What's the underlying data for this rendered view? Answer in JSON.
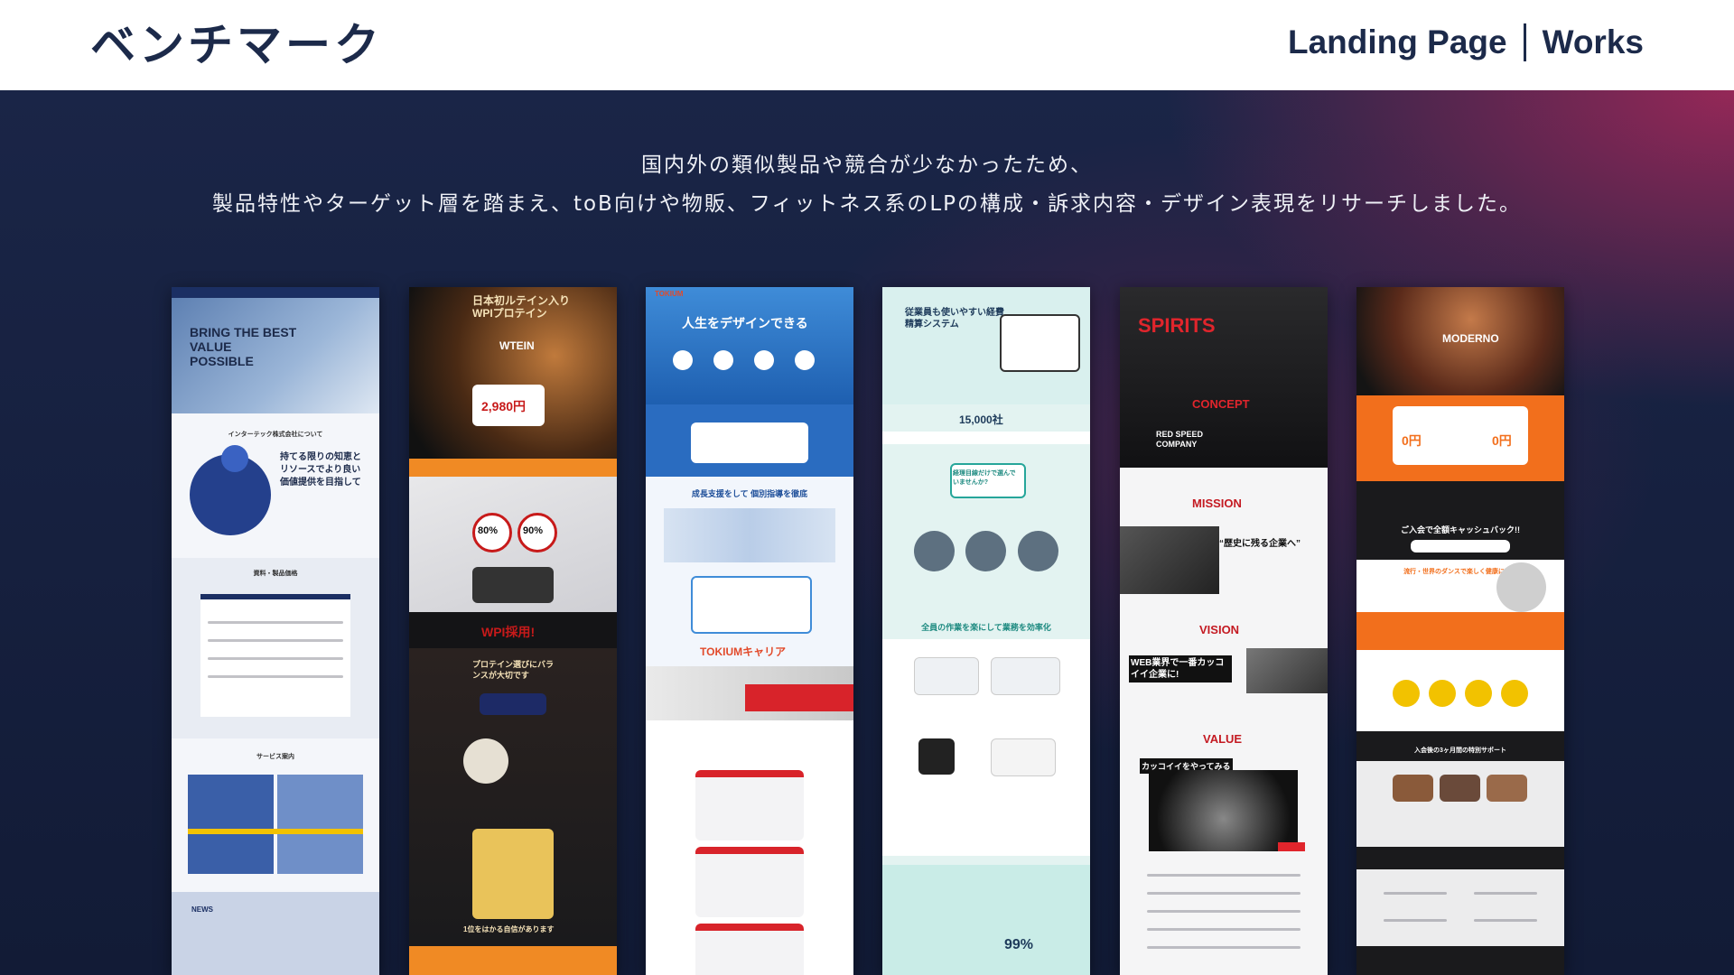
{
  "header": {
    "title": "ベンチマーク",
    "nav_left": "Landing Page",
    "nav_right": "Works"
  },
  "description": {
    "line1": "国内外の類似製品や競合が少なかったため、",
    "line2": "製品特性やターゲット層を踏まえ、toB向けや物販、フィットネス系のLPの構成・訴求内容・デザイン表現をリサーチしました。"
  },
  "cards": [
    {
      "name": "B2B tech landing page",
      "headline": "BRING THE BEST VALUE POSSIBLE",
      "section": "インターテック株式会社について",
      "tagline": "持てる限りの知恵とリソースでより良い価値提供を目指して",
      "form_title": "資料・製品価格",
      "service_title": "サービス案内",
      "news": "NEWS"
    },
    {
      "name": "Protein supplement landing page",
      "headline": "日本初ルテイン入りWPIプロテイン",
      "product": "WTEIN",
      "price": "2,980円",
      "stat1": "80%",
      "stat2": "90%",
      "cta": "WPI採用!",
      "tagline": "プロテイン選びにバランスが大切です",
      "footer": "1位をはかる自信があります"
    },
    {
      "name": "Career coaching landing page",
      "brand": "TOKIUM",
      "headline": "人生をデザインできる",
      "section": "成長支援をして 個別指導を徹底",
      "footer": "TOKIUMキャリア"
    },
    {
      "name": "Expense system landing page",
      "headline": "従業員も使いやすい経費精算システム",
      "count": "15,000社",
      "question": "経理目線だけで選んでいませんか?",
      "section": "全員の作業を楽にして業務を効率化",
      "result": "99%"
    },
    {
      "name": "Corporate recruiting landing page",
      "headline": "SPIRITS",
      "sub1": "CONCEPT",
      "company": "RED SPEED COMPANY",
      "sub2": "MISSION",
      "mission_quote": "“歴史に残る企業へ”",
      "sub3": "VISION",
      "vision_text": "WEB業界で一番カッコイイ企業に!",
      "sub4": "VALUE",
      "value_text": "カッコイイをやってみる"
    },
    {
      "name": "Fitness gym landing page",
      "brand": "MODERNO",
      "campaign": "ご入会で全額キャッシュバック!!",
      "price1": "0円",
      "price2": "0円",
      "section": "流行・世界のダンスで楽しく健康になる",
      "footer": "入会後の3ヶ月間の特別サポート"
    }
  ],
  "colors": {
    "header_bg": "#ffffff",
    "title_color": "#1c2a4a",
    "hero_start": "#1a2547",
    "hero_accent": "#aa285a",
    "text_light": "#eef0f6"
  }
}
